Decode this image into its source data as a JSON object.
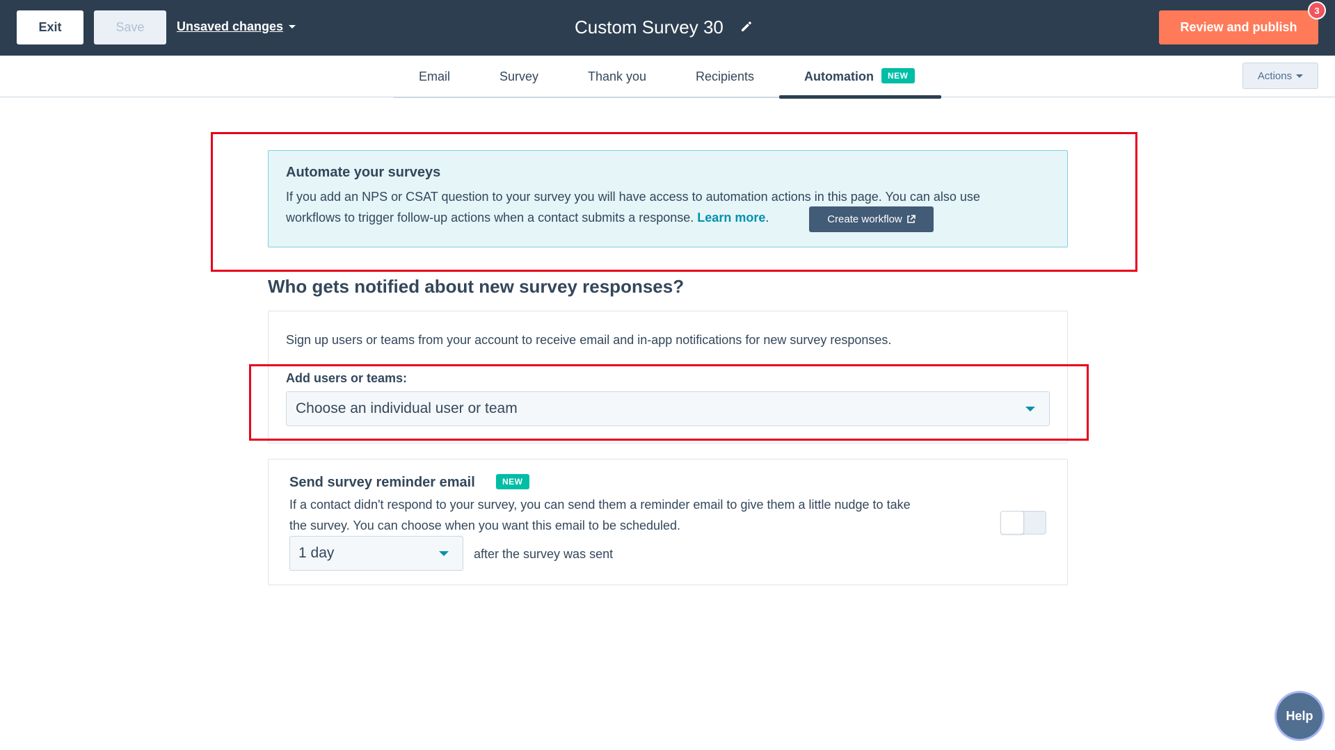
{
  "header": {
    "exit_label": "Exit",
    "save_label": "Save",
    "unsaved_label": "Unsaved changes",
    "survey_title": "Custom Survey 30",
    "review_label": "Review and publish",
    "notification_count": "3"
  },
  "tabs": [
    {
      "label": "Email"
    },
    {
      "label": "Survey"
    },
    {
      "label": "Thank you"
    },
    {
      "label": "Recipients"
    },
    {
      "label": "Automation",
      "badge": "NEW",
      "active": true
    }
  ],
  "actions_label": "Actions",
  "automate": {
    "title": "Automate your surveys",
    "text_line1": "If you add an NPS or CSAT question to your survey you will have access to automation actions in this page. You can also use",
    "text_line2": "workflows to trigger follow-up actions when a contact submits a response.",
    "learn_more": "Learn more",
    "period": ".",
    "create_workflow": "Create workflow"
  },
  "notify": {
    "heading": "Who gets notified about new survey responses?",
    "description": "Sign up users or teams from your account to receive email and in-app notifications for new survey responses.",
    "add_label": "Add users or teams:",
    "select_placeholder": "Choose an individual user or team"
  },
  "reminder": {
    "title": "Send survey reminder email",
    "badge": "NEW",
    "text_line1": "If a contact didn't respond to your survey, you can send them a reminder email to give them a little nudge to take",
    "text_line2": "the survey. You can choose when you want this email to be scheduled.",
    "day_value": "1 day",
    "after_text": "after the survey was sent",
    "enabled": false
  },
  "help_label": "Help",
  "colors": {
    "topbar": "#2d3e50",
    "accent_orange": "#ff7a59",
    "teal": "#00bda5",
    "link": "#0091ae",
    "annotation_red": "#e8001c"
  }
}
